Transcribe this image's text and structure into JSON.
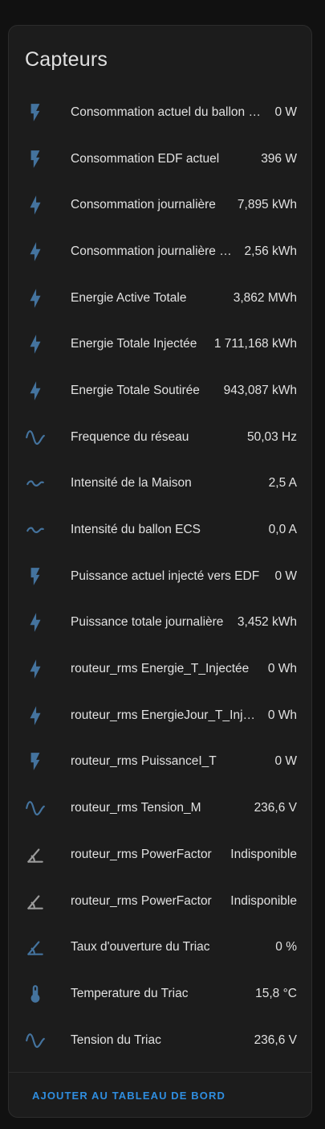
{
  "card": {
    "title": "Capteurs",
    "action_label": "AJOUTER AU TABLEAU DE BORD"
  },
  "colors": {
    "icon_blue": "#44739e",
    "icon_gray": "#9b9b9b",
    "accent": "#2f8ee0"
  },
  "sensors": [
    {
      "name": "Consommation actuel du ballon ECS",
      "value": "0 W",
      "icon": "flash-icon"
    },
    {
      "name": "Consommation EDF actuel",
      "value": "396 W",
      "icon": "flash-icon"
    },
    {
      "name": "Consommation journalière",
      "value": "7,895 kWh",
      "icon": "lightning-icon"
    },
    {
      "name": "Consommation journalière ECS",
      "value": "2,56 kWh",
      "icon": "lightning-icon"
    },
    {
      "name": "Energie Active Totale",
      "value": "3,862 MWh",
      "icon": "lightning-icon"
    },
    {
      "name": "Energie Totale Injectée",
      "value": "1 711,168 kWh",
      "icon": "lightning-icon"
    },
    {
      "name": "Energie Totale Soutirée",
      "value": "943,087 kWh",
      "icon": "lightning-icon"
    },
    {
      "name": "Frequence du réseau",
      "value": "50,03 Hz",
      "icon": "sine-wave-icon"
    },
    {
      "name": "Intensité de la Maison",
      "value": "2,5 A",
      "icon": "current-ac-icon"
    },
    {
      "name": "Intensité du ballon ECS",
      "value": "0,0 A",
      "icon": "current-ac-icon"
    },
    {
      "name": "Puissance actuel injecté vers EDF",
      "value": "0 W",
      "icon": "flash-icon"
    },
    {
      "name": "Puissance totale journalière",
      "value": "3,452 kWh",
      "icon": "lightning-icon"
    },
    {
      "name": "routeur_rms Energie_T_Injectée",
      "value": "0 Wh",
      "icon": "lightning-icon"
    },
    {
      "name": "routeur_rms EnergieJour_T_Injectée",
      "value": "0 Wh",
      "icon": "lightning-icon"
    },
    {
      "name": "routeur_rms PuissanceI_T",
      "value": "0 W",
      "icon": "flash-icon"
    },
    {
      "name": "routeur_rms Tension_M",
      "value": "236,6 V",
      "icon": "sine-wave-icon"
    },
    {
      "name": "routeur_rms PowerFactor",
      "value": "Indisponible",
      "icon": "angle-gray-icon"
    },
    {
      "name": "routeur_rms PowerFactor",
      "value": "Indisponible",
      "icon": "angle-gray-icon"
    },
    {
      "name": "Taux d'ouverture du Triac",
      "value": "0 %",
      "icon": "angle-icon"
    },
    {
      "name": "Temperature du Triac",
      "value": "15,8 °C",
      "icon": "thermometer-icon"
    },
    {
      "name": "Tension du Triac",
      "value": "236,6 V",
      "icon": "sine-wave-icon"
    }
  ]
}
